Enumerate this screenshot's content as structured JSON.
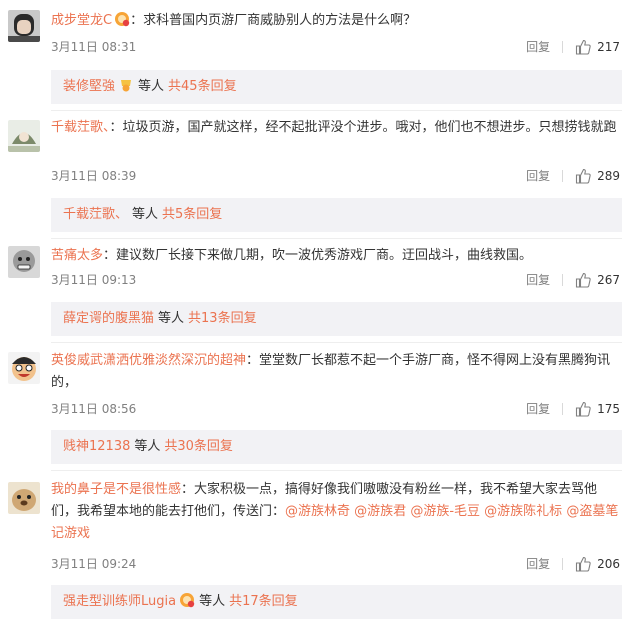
{
  "comments": [
    {
      "user": "成步堂龙C",
      "sep": "：",
      "text": "求科普国内页游厂商威胁别人的方法是什么啊？",
      "time": "3月11日 08:31",
      "reply": "回复",
      "likes": "217",
      "sub": {
        "user": "装修堅強",
        "etc": "等人",
        "total": "共45条回复"
      }
    },
    {
      "user": "千载茳歌、",
      "sep": "：",
      "text": "垃圾页游，国产就这样，经不起批评没个进步。哦对，他们也不想进步。只想捞钱就跑",
      "time": "3月11日 08:39",
      "reply": "回复",
      "likes": "289",
      "sub": {
        "user": "千载茳歌、",
        "etc": "等人",
        "total": "共5条回复"
      }
    },
    {
      "user": "苦痛太多",
      "sep": "：",
      "text": "建议数厂长接下来做几期，吹一波优秀游戏厂商。迂回战斗，曲线救国。",
      "time": "3月11日 09:13",
      "reply": "回复",
      "likes": "267",
      "sub": {
        "user": "薛定谔的腹黑猫",
        "etc": "等人",
        "total": "共13条回复"
      }
    },
    {
      "user": "英俊威武潇洒优雅淡然深沉的超神",
      "sep": "：",
      "text": "堂堂数厂长都惹不起一个手游厂商，怪不得网上没有黑腾狗讯的，",
      "time": "3月11日 08:56",
      "reply": "回复",
      "likes": "175",
      "sub": {
        "user": "贱神12138",
        "etc": "等人",
        "total": "共30条回复"
      }
    },
    {
      "user": "我的鼻子是不是很性感",
      "sep": "：",
      "text": "大家积极一点，搞得好像我们嗷嗷没有粉丝一样，我不希望大家去骂他们，我希望本地的能去打他们，传送门：",
      "mentions": [
        "@游族林奇",
        "@游族君",
        "@游族-毛豆",
        "@游族陈礼标",
        "@盗墓笔记游戏"
      ],
      "time": "3月11日 09:24",
      "reply": "回复",
      "likes": "206",
      "sub": {
        "user": "强走型训练师Lugia",
        "etc": "等人",
        "total": "共17条回复"
      }
    }
  ],
  "colors": {
    "link": "#eb7350",
    "text": "#333333",
    "meta": "#808080",
    "sub_bg": "#f2f2f5"
  }
}
